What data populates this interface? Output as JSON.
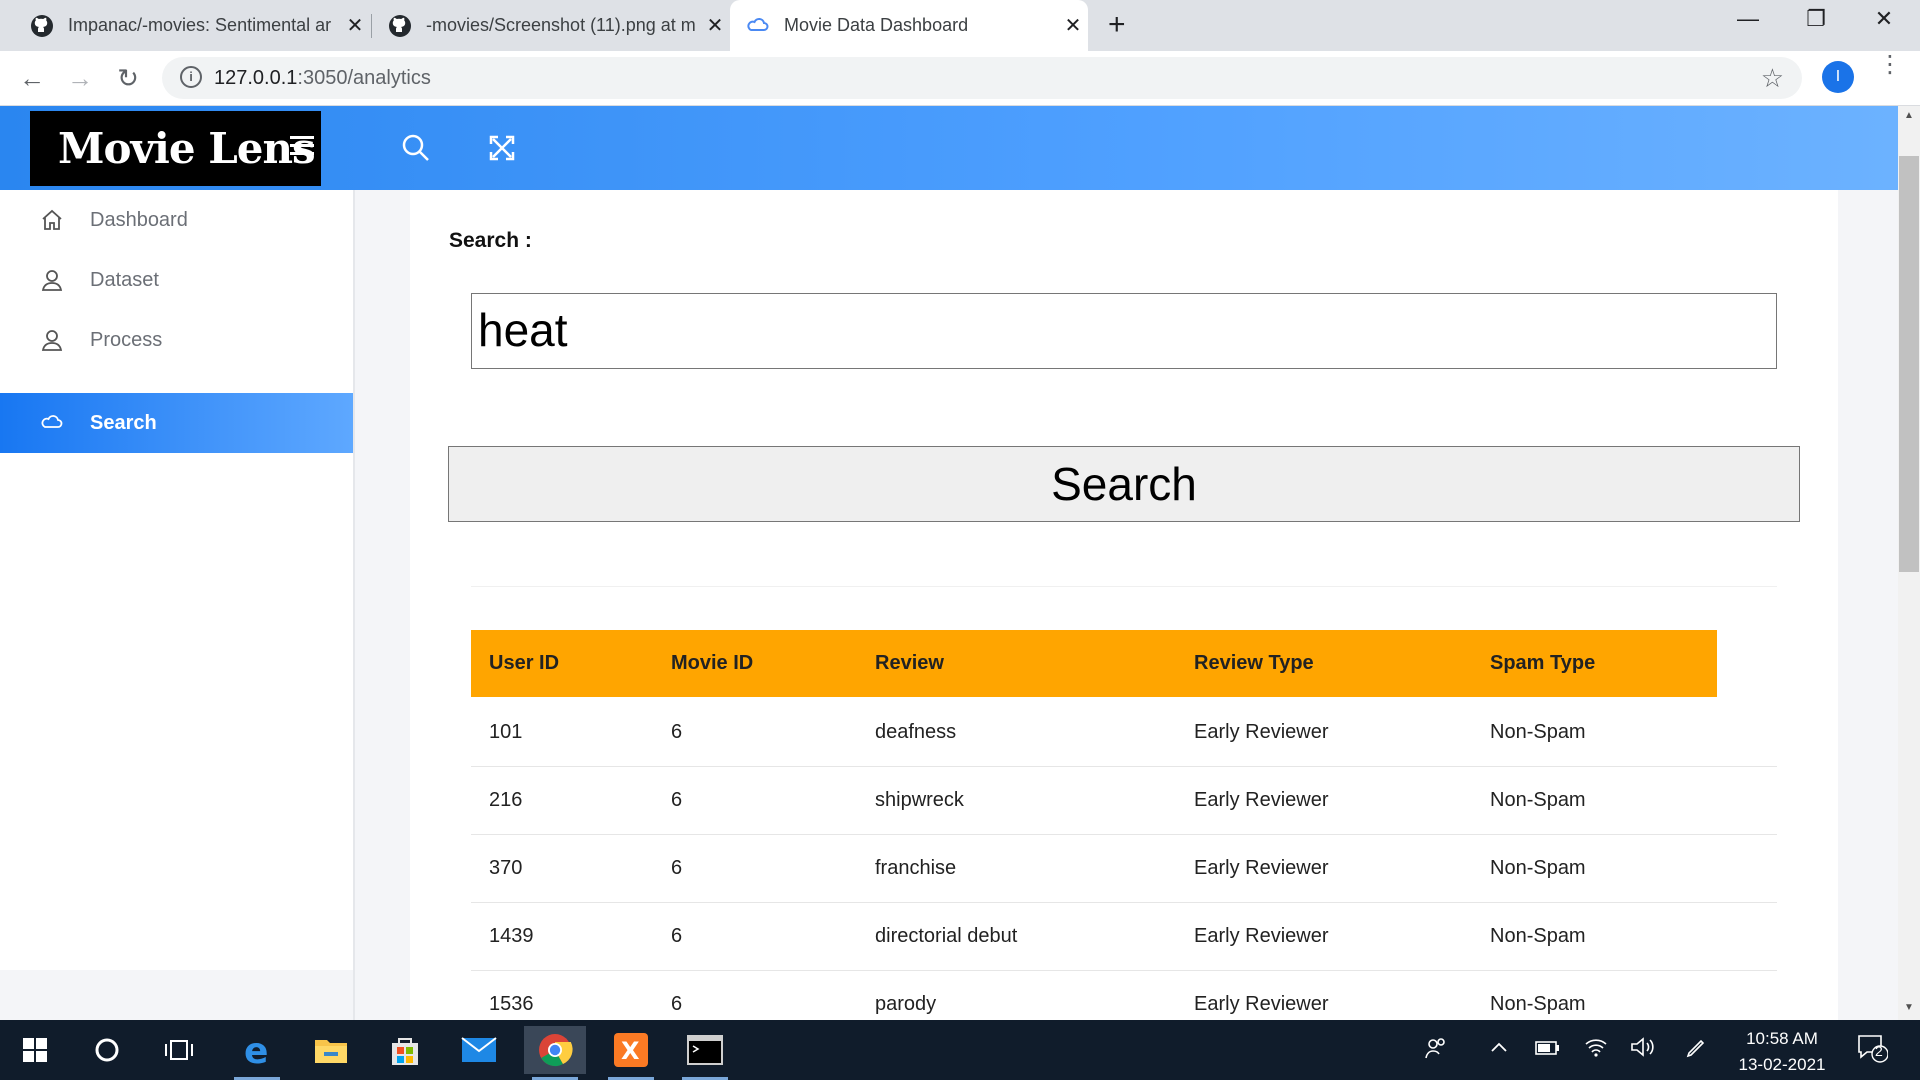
{
  "browser": {
    "tabs": [
      {
        "title": "Impanac/-movies: Sentimental ar",
        "close": "✕"
      },
      {
        "title": "-movies/Screenshot (11).png at m",
        "close": "✕"
      },
      {
        "title": "Movie Data Dashboard",
        "close": "✕"
      }
    ],
    "url_host": "127.0.0.1",
    "url_rest": ":3050/analytics",
    "profile_initial": "I"
  },
  "header": {
    "logo": "Movie Lens"
  },
  "sidebar": {
    "items": [
      {
        "label": "Dashboard",
        "icon": "home-icon"
      },
      {
        "label": "Dataset",
        "icon": "user-icon"
      },
      {
        "label": "Process",
        "icon": "user-icon"
      },
      {
        "label": "Search",
        "icon": "cloud-icon",
        "active": true
      }
    ]
  },
  "search": {
    "label": "Search :",
    "value": "heat",
    "button": "Search"
  },
  "table": {
    "headers": [
      "User ID",
      "Movie ID",
      "Review",
      "Review Type",
      "Spam Type"
    ],
    "rows": [
      [
        "101",
        "6",
        "deafness",
        "Early Reviewer",
        "Non-Spam"
      ],
      [
        "216",
        "6",
        "shipwreck",
        "Early Reviewer",
        "Non-Spam"
      ],
      [
        "370",
        "6",
        "franchise",
        "Early Reviewer",
        "Non-Spam"
      ],
      [
        "1439",
        "6",
        "directorial debut",
        "Early Reviewer",
        "Non-Spam"
      ],
      [
        "1536",
        "6",
        "parody",
        "Early Reviewer",
        "Non-Spam"
      ]
    ]
  },
  "taskbar": {
    "time": "10:58 AM",
    "date": "13-02-2021",
    "notifications": "2"
  },
  "colors": {
    "header_gradient_start": "#2a86f0",
    "active_nav": "#1877f2",
    "table_header": "#ffa500"
  }
}
